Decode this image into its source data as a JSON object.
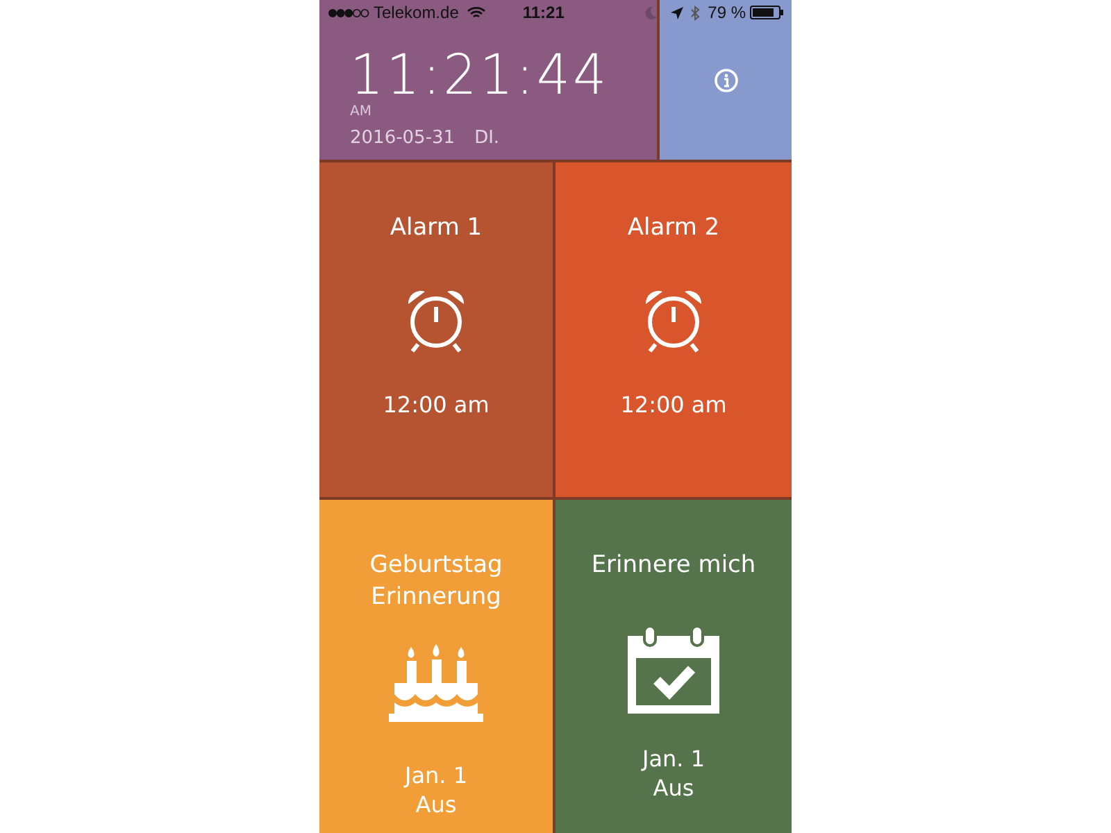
{
  "status_bar": {
    "carrier": "Telekom.de",
    "time": "11:21",
    "battery": "79 %"
  },
  "clock": {
    "time": "11:21:44",
    "meridiem": "AM",
    "date": "2016-05-31",
    "weekday": "DI."
  },
  "tiles": [
    {
      "kind": "alarm",
      "title": "Alarm 1",
      "lines": [
        "12:00 am"
      ],
      "color": "#b65331"
    },
    {
      "kind": "alarm",
      "title": "Alarm 2",
      "lines": [
        "12:00 am"
      ],
      "color": "#d9552b"
    },
    {
      "kind": "birthday",
      "title": "Geburtstag Erinnerung",
      "lines": [
        "Jan. 1",
        "Aus"
      ],
      "color": "#f29e38"
    },
    {
      "kind": "reminder",
      "title": "Erinnere mich",
      "lines": [
        "Jan. 1",
        "Aus"
      ],
      "color": "#56744b"
    }
  ]
}
